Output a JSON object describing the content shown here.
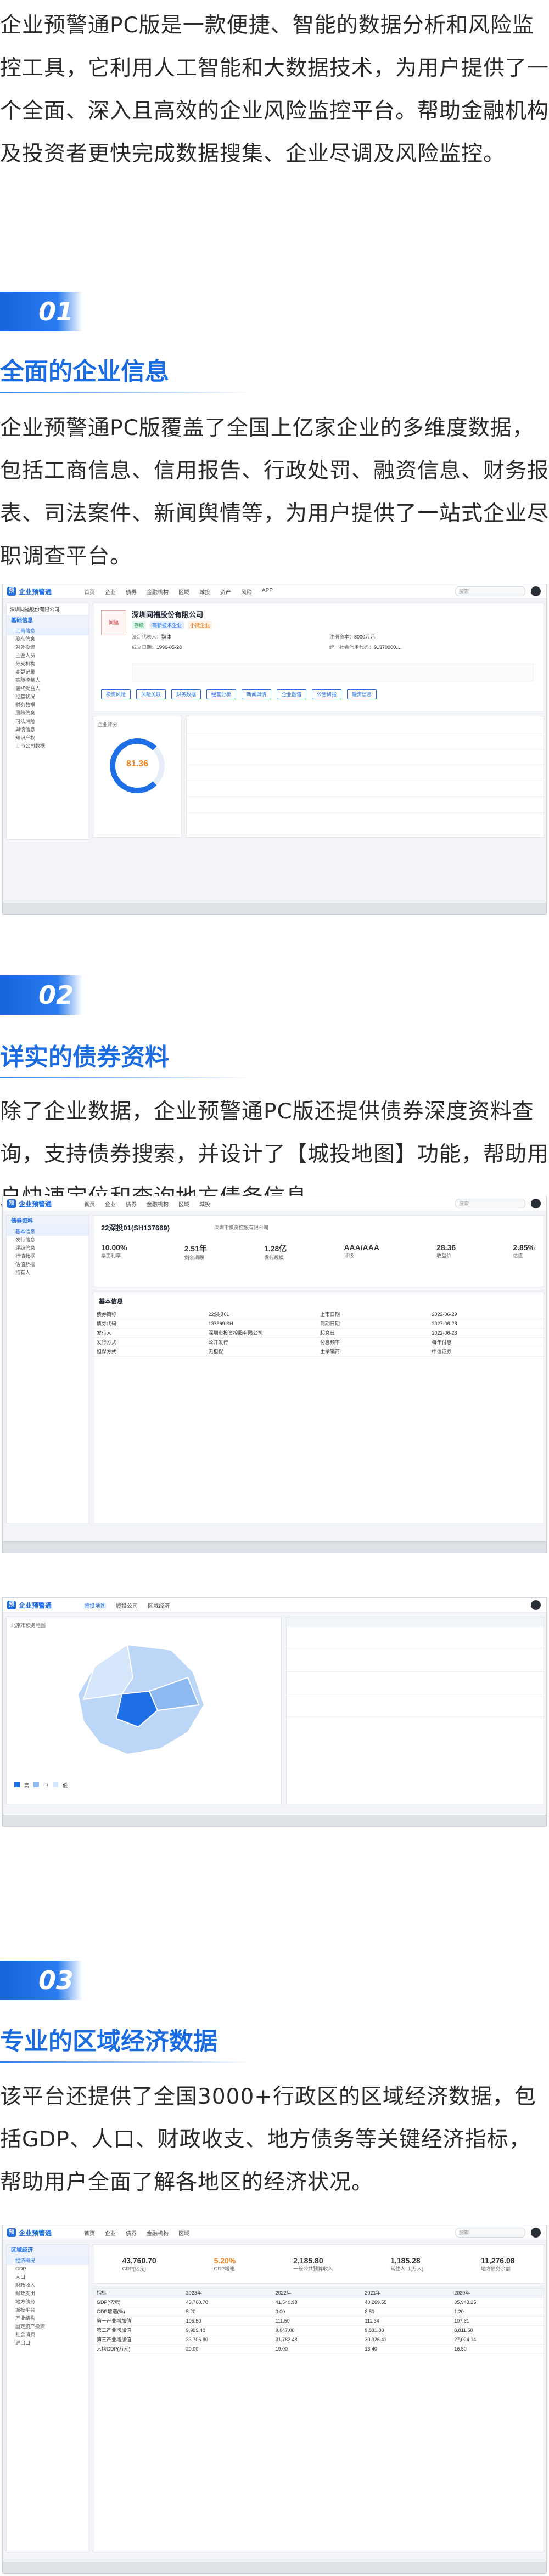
{
  "intro": {
    "text": "企业预警通PC版是一款便捷、智能的数据分析和风险监控工具，它利用人工智能和大数据技术，为用户提供了一个全面、深入且高效的企业风险监控平台。帮助金融机构及投资者更快完成数据搜集、企业尽调及风险监控。"
  },
  "sections": [
    {
      "num": "01",
      "title": "全面的企业信息",
      "body": "企业预警通PC版覆盖了全国上亿家企业的多维度数据，包括工商信息、信用报告、行政处罚、融资信息、财务报表、司法案件、新闻舆情等，为用户提供了一站式企业尽职调查平台。"
    },
    {
      "num": "02",
      "title": "详实的债券资料",
      "body": "除了企业数据，企业预警通PC版还提供债券深度资料查询，支持债券搜索，并设计了【城投地图】功能，帮助用户快速定位和查询地方债务信息。"
    },
    {
      "num": "03",
      "title": "专业的区域经济数据",
      "body": "该平台还提供了全国3000+行政区的区域经济数据，包括GDP、人口、财政收支、地方债务等关键经济指标，帮助用户全面了解各地区的经济状况。"
    }
  ],
  "app": {
    "logo_text": "企业预警通",
    "nav": [
      "首页",
      "企业",
      "债券",
      "金融机构",
      "区域",
      "城投",
      "资产",
      "风险",
      "APP"
    ],
    "search_placeholder": "搜索",
    "colors": {
      "brand": "#1e6fe6",
      "accent": "#f0821d",
      "success": "#22a35a"
    }
  },
  "shot1": {
    "company_name": "深圳同福股份有限公司",
    "sidebar_head": "基础信息",
    "sidebar_items": [
      "工商信息",
      "股东信息",
      "对外投资",
      "主要人员",
      "分支机构",
      "变更记录",
      "实际控制人",
      "最终受益人",
      "经营状况",
      "财务数据",
      "风险信息",
      "司法风险",
      "舆情信息",
      "知识产权",
      "上市公司数据"
    ],
    "score_label": "企业评分",
    "score": "81.36",
    "tags": [
      "存续",
      "高新技术企业",
      "小微企业"
    ],
    "fields": [
      {
        "k": "法定代表人",
        "v": "魏沐"
      },
      {
        "k": "注册资本",
        "v": "8000万元"
      },
      {
        "k": "成立日期",
        "v": "1996-05-28"
      },
      {
        "k": "统一社会信用代码",
        "v": "91370000...."
      }
    ],
    "tab_labels": [
      "投资风险",
      "风险关联",
      "财务数据",
      "经营分析",
      "新闻舆情",
      "企业图谱",
      "公告研报",
      "融资信息"
    ]
  },
  "shot2": {
    "bond_title": "22深投01(SH137669)",
    "issuer": "深圳市投资控股有限公司",
    "metrics": [
      {
        "k": "票面利率",
        "v": "10.00%"
      },
      {
        "k": "剩余期限",
        "v": "2.51年"
      },
      {
        "k": "发行规模",
        "v": "1.28亿"
      },
      {
        "k": "评级",
        "v": "AAA/AAA"
      },
      {
        "k": "收盘价",
        "v": "28.36"
      },
      {
        "k": "估值",
        "v": "2.85%"
      }
    ],
    "section_title": "基本信息",
    "table_rows": [
      [
        "债券简称",
        "22深投01",
        "上市日期",
        "2022-06-29"
      ],
      [
        "债券代码",
        "137669.SH",
        "到期日期",
        "2027-06-28"
      ],
      [
        "发行人",
        "深圳市投资控股有限公司",
        "起息日",
        "2022-06-28"
      ],
      [
        "发行方式",
        "公开发行",
        "付息频率",
        "每年付息"
      ],
      [
        "担保方式",
        "无担保",
        "主承销商",
        "中信证券"
      ]
    ],
    "map_title": "北京市债务地图",
    "map_legend": [
      "高",
      "中",
      "低"
    ],
    "region_tabs": [
      "城投地图",
      "城投公司",
      "区域经济"
    ]
  },
  "shot3": {
    "sidebar_head": "区域经济",
    "sidebar_items": [
      "经济概况",
      "GDP",
      "人口",
      "财政收入",
      "财政支出",
      "地方债务",
      "城投平台",
      "产业结构",
      "固定资产投资",
      "社会消费",
      "进出口"
    ],
    "cards": [
      {
        "k": "GDP(亿元)",
        "v": "43,760.70"
      },
      {
        "k": "GDP增速",
        "v": "5.20%"
      },
      {
        "k": "一般公共预算收入",
        "v": "2,185.80"
      },
      {
        "k": "常住人口(万人)",
        "v": "1,185.28"
      },
      {
        "k": "地方债务余额",
        "v": "11,276.08"
      }
    ],
    "table_head": [
      "指标",
      "2023年",
      "2022年",
      "2021年",
      "2020年"
    ],
    "table_rows": [
      [
        "GDP(亿元)",
        "43,760.70",
        "41,540.98",
        "40,269.55",
        "35,943.25"
      ],
      [
        "GDP增速(%)",
        "5.20",
        "3.00",
        "8.50",
        "1.20"
      ],
      [
        "第一产业增加值",
        "105.50",
        "111.50",
        "111.34",
        "107.61"
      ],
      [
        "第二产业增加值",
        "9,999.40",
        "9,647.00",
        "9,831.80",
        "8,811.50"
      ],
      [
        "第三产业增加值",
        "33,706.80",
        "31,782.48",
        "30,326.41",
        "27,024.14"
      ],
      [
        "人均GDP(万元)",
        "20.00",
        "19.00",
        "18.40",
        "16.50"
      ]
    ]
  }
}
